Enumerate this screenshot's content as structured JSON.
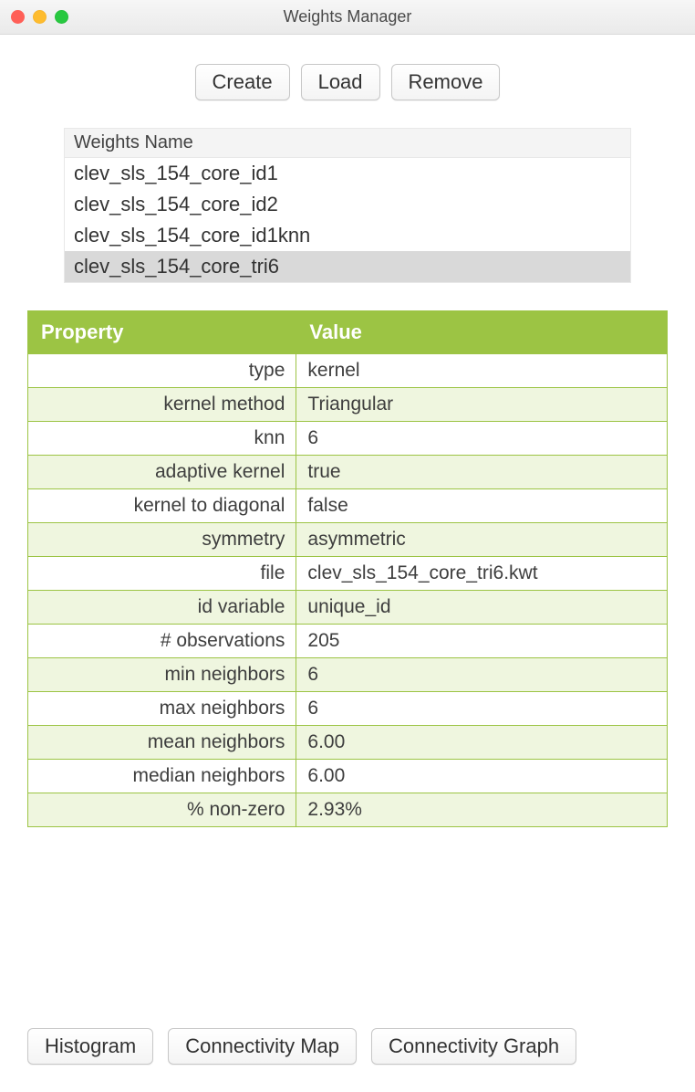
{
  "window": {
    "title": "Weights Manager"
  },
  "toolbar": {
    "create": "Create",
    "load": "Load",
    "remove": "Remove"
  },
  "weights_list": {
    "header": "Weights Name",
    "items": [
      {
        "name": "clev_sls_154_core_id1",
        "selected": false
      },
      {
        "name": "clev_sls_154_core_id2",
        "selected": false
      },
      {
        "name": "clev_sls_154_core_id1knn",
        "selected": false
      },
      {
        "name": "clev_sls_154_core_tri6",
        "selected": true
      }
    ]
  },
  "prop_table": {
    "head_property": "Property",
    "head_value": "Value",
    "rows": [
      {
        "k": "type",
        "v": "kernel"
      },
      {
        "k": "kernel method",
        "v": "Triangular"
      },
      {
        "k": "knn",
        "v": "6"
      },
      {
        "k": "adaptive kernel",
        "v": "true"
      },
      {
        "k": "kernel to diagonal",
        "v": "false"
      },
      {
        "k": "symmetry",
        "v": "asymmetric"
      },
      {
        "k": "file",
        "v": "clev_sls_154_core_tri6.kwt"
      },
      {
        "k": "id variable",
        "v": "unique_id"
      },
      {
        "k": "# observations",
        "v": "205"
      },
      {
        "k": "min neighbors",
        "v": "6"
      },
      {
        "k": "max neighbors",
        "v": "6"
      },
      {
        "k": "mean neighbors",
        "v": "6.00"
      },
      {
        "k": "median neighbors",
        "v": "6.00"
      },
      {
        "k": "% non-zero",
        "v": "2.93%"
      }
    ]
  },
  "footer": {
    "histogram": "Histogram",
    "conn_map": "Connectivity Map",
    "conn_graph": "Connectivity Graph"
  }
}
